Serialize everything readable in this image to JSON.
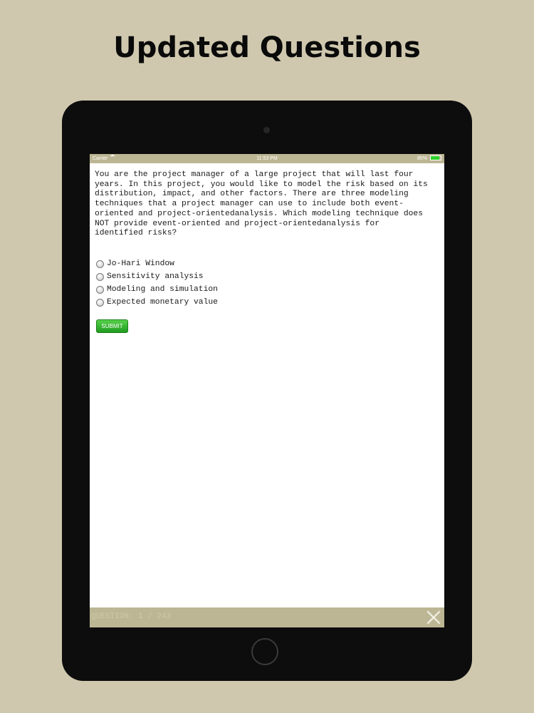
{
  "headline": "Updated Questions",
  "status_bar": {
    "carrier": "Carrier",
    "time": "11:53 PM",
    "battery": "85%",
    "battery_level": 0.85
  },
  "quiz": {
    "question": "You are the project manager of a large project that will last four\nyears. In this project, you would like to model the risk based on its\ndistribution, impact, and other factors. There are three modeling\ntechniques that a project manager can use to include both event-\noriented and project-orientedanalysis. Which modeling technique does\nNOT provide event-oriented and project-orientedanalysis for\nidentified risks?",
    "options": [
      "Jo-Hari Window",
      "Sensitivity analysis",
      "Modeling and simulation",
      "Expected monetary value"
    ],
    "submit_label": "SUBMIT"
  },
  "footer": {
    "counter": "QUESTION: 1 / 243"
  },
  "icons": {
    "wifi": "wifi-icon",
    "battery": "battery-icon",
    "close": "close-icon",
    "radio": "radio-icon"
  },
  "colors": {
    "background": "#cfc8ae",
    "bar": "#bdb694",
    "submit": "#2aa82a",
    "battery_fill": "#2fd12a"
  }
}
